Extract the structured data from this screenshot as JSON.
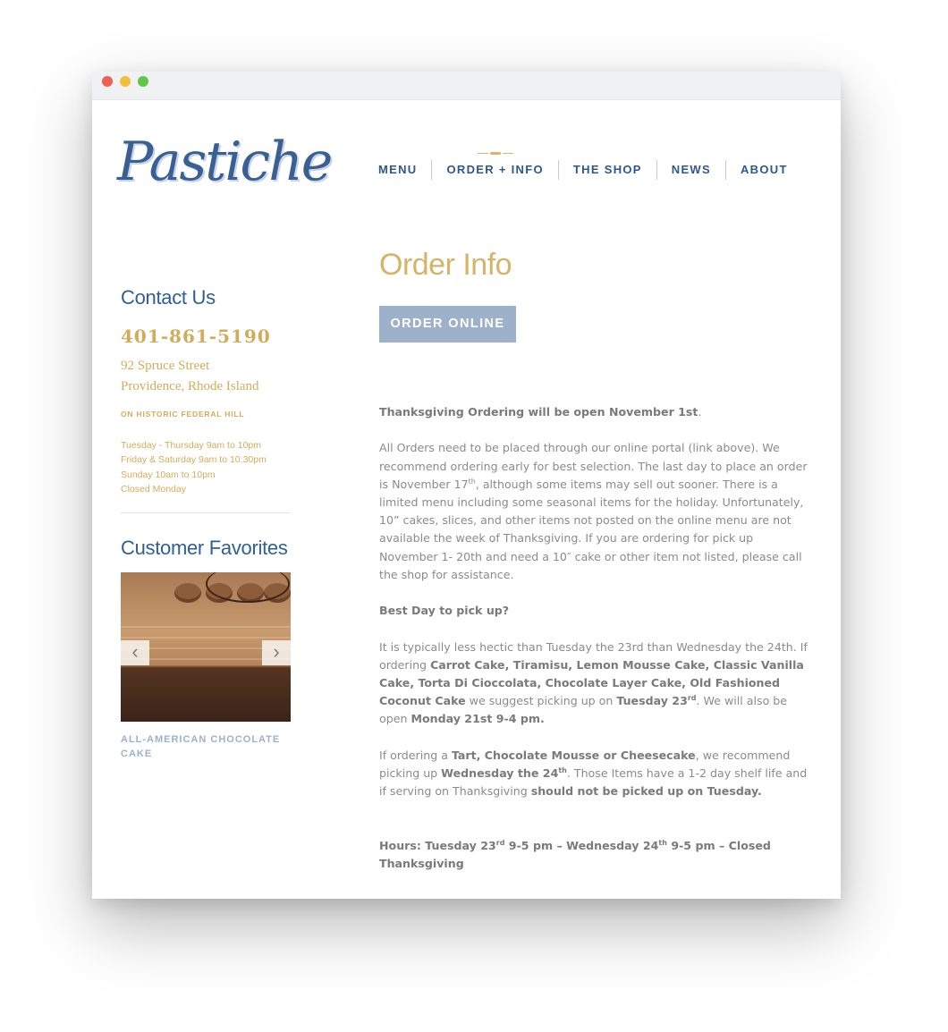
{
  "window": {
    "controls": [
      "close",
      "minimize",
      "maximize"
    ]
  },
  "logo": {
    "text": "Pastiche"
  },
  "nav": {
    "items": [
      {
        "label": "MENU"
      },
      {
        "label": "ORDER + INFO",
        "active": true
      },
      {
        "label": "THE SHOP"
      },
      {
        "label": "NEWS"
      },
      {
        "label": "ABOUT"
      }
    ]
  },
  "sidebar": {
    "contact_title": "Contact Us",
    "phone": "401-861-5190",
    "address_line1": "92 Spruce Street",
    "address_line2": "Providence, Rhode Island",
    "tagline": "ON HISTORIC FEDERAL HILL",
    "hours": [
      "Tuesday - Thursday 9am to 10pm",
      "Friday & Saturday 9am to 10:30pm",
      "Sunday 10am to 10pm",
      "Closed Monday"
    ],
    "favorites_title": "Customer Favorites",
    "favorite_caption": "ALL-AMERICAN CHOCOLATE CAKE",
    "prev_arrow": "‹",
    "next_arrow": "›"
  },
  "main": {
    "title": "Order Info",
    "order_button": "ORDER ONLINE",
    "p1": {
      "bold": "Thanksgiving Ordering will be open November 1st",
      "tail": "."
    },
    "p2": {
      "a": "All Orders need to be placed through our online portal (link above). We recommend ordering early for best selection. The last day to place an order is November 17",
      "sup": "th",
      "b": ", although some items may sell out sooner. There is a limited menu including some seasonal items for the holiday. Unfortunately, 10” cakes, slices, and other items not posted on the online menu are not available the week of Thanksgiving. If you are ordering for pick up November 1- 20th and need a 10″ cake or other item not listed, please call the shop for assistance."
    },
    "p3": {
      "bold": "Best Day to pick up?"
    },
    "p4": {
      "a": "It is typically less hectic than Tuesday the 23rd than Wednesday the 24th. If ordering ",
      "b_bold": "Carrot Cake, Tiramisu, Lemon Mousse Cake, Classic Vanilla Cake, Torta Di Cioccolata, Chocolate Layer Cake, Old Fashioned Coconut Cake",
      "c": " we suggest picking up on ",
      "d_bold": "Tuesday 23",
      "d_sup": "rd",
      "e": ". We will also be open ",
      "f_bold": "Monday 21st 9-4 pm."
    },
    "p5": {
      "a": "If ordering a ",
      "b_bold": "Tart, Chocolate Mousse or Cheesecake",
      "c": ", we recommend picking up ",
      "d_bold": "Wednesday the 24",
      "d_sup": "th",
      "e": ". Those Items have a 1-2 day shelf life and if serving on Thanksgiving ",
      "f_bold": "should not be picked up on Tuesday."
    },
    "p6": {
      "a_bold": "Hours: Tuesday 23",
      "a_sup": "rd",
      "b_bold": "  9-5 pm  – Wednesday 24",
      "b_sup": "th",
      "c_bold": "  9-5 pm  –  Closed Thanksgiving"
    }
  }
}
